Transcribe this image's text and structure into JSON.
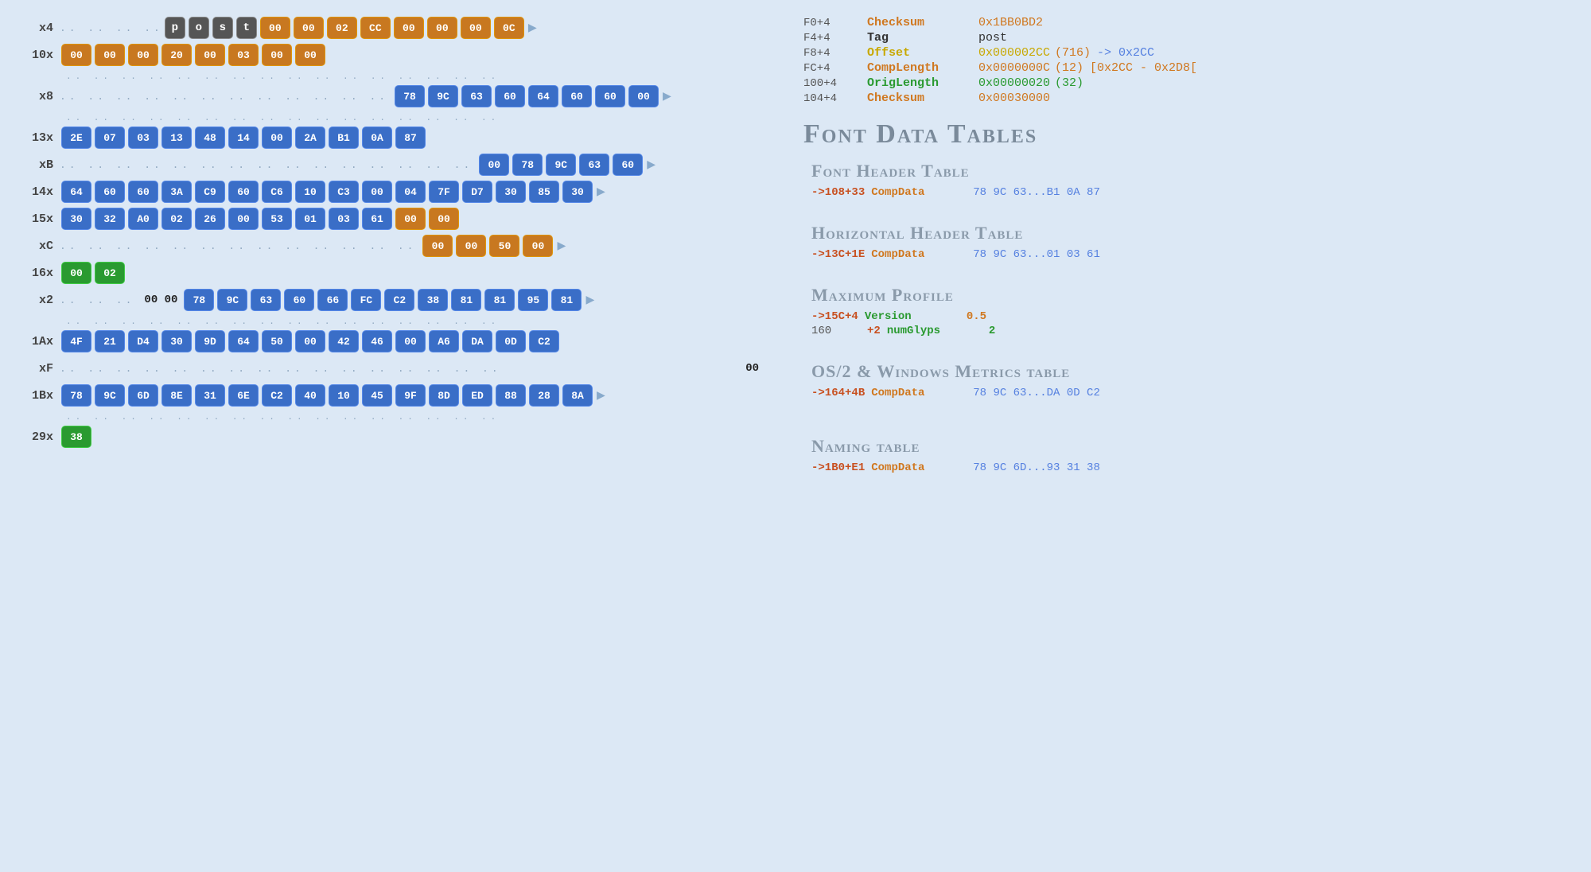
{
  "left": {
    "rows": [
      {
        "id": "row-x4",
        "label": "x4",
        "prefix_dots": ".. .. .. ..",
        "items": [
          {
            "text": "p",
            "type": "gray"
          },
          {
            "text": "o",
            "type": "gray"
          },
          {
            "text": "s",
            "type": "gray"
          },
          {
            "text": "t",
            "type": "gray"
          },
          {
            "text": "00",
            "type": "orange"
          },
          {
            "text": "00",
            "type": "orange"
          },
          {
            "text": "02",
            "type": "orange"
          },
          {
            "text": "CC",
            "type": "orange"
          },
          {
            "text": "00",
            "type": "orange"
          },
          {
            "text": "00",
            "type": "orange"
          },
          {
            "text": "00",
            "type": "orange"
          },
          {
            "text": "0C",
            "type": "orange"
          }
        ],
        "has_arrow": true
      },
      {
        "id": "row-10x",
        "label": "10x",
        "prefix_dots": "",
        "items": [
          {
            "text": "00",
            "type": "orange"
          },
          {
            "text": "00",
            "type": "orange"
          },
          {
            "text": "00",
            "type": "orange"
          },
          {
            "text": "20",
            "type": "orange"
          },
          {
            "text": "00",
            "type": "orange"
          },
          {
            "text": "03",
            "type": "orange"
          },
          {
            "text": "00",
            "type": "orange"
          },
          {
            "text": "00",
            "type": "orange"
          }
        ],
        "has_arrow": false
      },
      {
        "id": "dots-x8-pre",
        "type": "dots",
        "dots": ".. .. .. .. .. .. .. .. .. .. .. .. .. .. .. .."
      },
      {
        "id": "row-x8",
        "label": "x8",
        "prefix_dots": ".. .. .. .. .. .. .. .. .. .. .. ..",
        "items": [
          {
            "text": "78",
            "type": "blue"
          },
          {
            "text": "9C",
            "type": "blue"
          },
          {
            "text": "63",
            "type": "blue"
          },
          {
            "text": "60",
            "type": "blue"
          },
          {
            "text": "64",
            "type": "blue"
          },
          {
            "text": "60",
            "type": "blue"
          },
          {
            "text": "60",
            "type": "blue"
          },
          {
            "text": "00",
            "type": "blue"
          }
        ],
        "has_arrow": true
      },
      {
        "id": "dots-13x-pre",
        "type": "dots",
        "dots": ".. .. .. .. .. .. .. .. .. .. .. .. .. .. .. .."
      },
      {
        "id": "row-13x",
        "label": "13x",
        "prefix_dots": "",
        "items": [
          {
            "text": "2E",
            "type": "blue"
          },
          {
            "text": "07",
            "type": "blue"
          },
          {
            "text": "03",
            "type": "blue"
          },
          {
            "text": "13",
            "type": "blue"
          },
          {
            "text": "48",
            "type": "blue"
          },
          {
            "text": "14",
            "type": "blue"
          },
          {
            "text": "00",
            "type": "blue"
          },
          {
            "text": "2A",
            "type": "blue"
          },
          {
            "text": "B1",
            "type": "blue"
          },
          {
            "text": "0A",
            "type": "blue"
          },
          {
            "text": "87",
            "type": "blue"
          }
        ],
        "has_arrow": false
      },
      {
        "id": "row-xB",
        "label": "xB",
        "prefix_dots": ".. .. .. .. .. .. .. .. .. .. .. .. .. .. ..",
        "items": [
          {
            "text": "00",
            "type": "blue"
          },
          {
            "text": "78",
            "type": "blue"
          },
          {
            "text": "9C",
            "type": "blue"
          },
          {
            "text": "63",
            "type": "blue"
          },
          {
            "text": "60",
            "type": "blue"
          }
        ],
        "has_arrow": true
      },
      {
        "id": "row-14x",
        "label": "14x",
        "prefix_dots": "",
        "items": [
          {
            "text": "64",
            "type": "blue"
          },
          {
            "text": "60",
            "type": "blue"
          },
          {
            "text": "60",
            "type": "blue"
          },
          {
            "text": "3A",
            "type": "blue"
          },
          {
            "text": "C9",
            "type": "blue"
          },
          {
            "text": "60",
            "type": "blue"
          },
          {
            "text": "C6",
            "type": "blue"
          },
          {
            "text": "10",
            "type": "blue"
          },
          {
            "text": "C3",
            "type": "blue"
          },
          {
            "text": "00",
            "type": "blue"
          },
          {
            "text": "04",
            "type": "blue"
          },
          {
            "text": "7F",
            "type": "blue"
          },
          {
            "text": "D7",
            "type": "blue"
          },
          {
            "text": "30",
            "type": "blue"
          },
          {
            "text": "85",
            "type": "blue"
          },
          {
            "text": "30",
            "type": "blue"
          }
        ],
        "has_arrow": true
      },
      {
        "id": "row-15x",
        "label": "15x",
        "prefix_dots": "",
        "items": [
          {
            "text": "30",
            "type": "blue"
          },
          {
            "text": "32",
            "type": "blue"
          },
          {
            "text": "A0",
            "type": "blue"
          },
          {
            "text": "02",
            "type": "blue"
          },
          {
            "text": "26",
            "type": "blue"
          },
          {
            "text": "00",
            "type": "blue"
          },
          {
            "text": "53",
            "type": "blue"
          },
          {
            "text": "01",
            "type": "blue"
          },
          {
            "text": "03",
            "type": "blue"
          },
          {
            "text": "61",
            "type": "blue"
          },
          {
            "text": "00",
            "type": "orange"
          },
          {
            "text": "00",
            "type": "orange"
          }
        ],
        "has_arrow": false
      },
      {
        "id": "row-xC",
        "label": "xC",
        "prefix_dots": ".. .. .. .. .. .. .. .. .. .. .. .. ..",
        "items": [
          {
            "text": "00",
            "type": "orange"
          },
          {
            "text": "00",
            "type": "orange"
          },
          {
            "text": "50",
            "type": "orange"
          },
          {
            "text": "00",
            "type": "orange"
          }
        ],
        "has_arrow": true
      },
      {
        "id": "row-16x",
        "label": "16x",
        "prefix_dots": "",
        "items": [
          {
            "text": "00",
            "type": "green"
          },
          {
            "text": "02",
            "type": "green"
          }
        ],
        "has_arrow": false
      },
      {
        "id": "row-x2",
        "label": "x2",
        "prefix_dots": ".. .. ..",
        "inline_text": "00 00",
        "items": [
          {
            "text": "78",
            "type": "blue"
          },
          {
            "text": "9C",
            "type": "blue"
          },
          {
            "text": "63",
            "type": "blue"
          },
          {
            "text": "60",
            "type": "blue"
          },
          {
            "text": "66",
            "type": "blue"
          },
          {
            "text": "FC",
            "type": "blue"
          },
          {
            "text": "C2",
            "type": "blue"
          },
          {
            "text": "38",
            "type": "blue"
          },
          {
            "text": "81",
            "type": "blue"
          },
          {
            "text": "81",
            "type": "blue"
          },
          {
            "text": "95",
            "type": "blue"
          },
          {
            "text": "81",
            "type": "blue"
          }
        ],
        "has_arrow": true
      },
      {
        "id": "dots-1ax-pre",
        "type": "dots",
        "dots": ".. .. .. .. .. .. .. .. .. .. .. .. .. .. .. .."
      },
      {
        "id": "row-1Ax",
        "label": "1Ax",
        "prefix_dots": "",
        "items": [
          {
            "text": "4F",
            "type": "blue"
          },
          {
            "text": "21",
            "type": "blue"
          },
          {
            "text": "D4",
            "type": "blue"
          },
          {
            "text": "30",
            "type": "blue"
          },
          {
            "text": "9D",
            "type": "blue"
          },
          {
            "text": "64",
            "type": "blue"
          },
          {
            "text": "50",
            "type": "blue"
          },
          {
            "text": "00",
            "type": "blue"
          },
          {
            "text": "42",
            "type": "blue"
          },
          {
            "text": "46",
            "type": "blue"
          },
          {
            "text": "00",
            "type": "blue"
          },
          {
            "text": "A6",
            "type": "blue"
          },
          {
            "text": "DA",
            "type": "blue"
          },
          {
            "text": "0D",
            "type": "blue"
          },
          {
            "text": "C2",
            "type": "blue"
          }
        ],
        "has_arrow": false
      },
      {
        "id": "row-xF",
        "label": "xF",
        "prefix_dots": ".. .. .. .. .. .. .. .. .. .. .. .. .. .. .. ..",
        "inline_end": "00",
        "items": [],
        "has_arrow": false
      },
      {
        "id": "row-1Bx",
        "label": "1Bx",
        "prefix_dots": "",
        "items": [
          {
            "text": "78",
            "type": "blue"
          },
          {
            "text": "9C",
            "type": "blue"
          },
          {
            "text": "6D",
            "type": "blue"
          },
          {
            "text": "8E",
            "type": "blue"
          },
          {
            "text": "31",
            "type": "blue"
          },
          {
            "text": "6E",
            "type": "blue"
          },
          {
            "text": "C2",
            "type": "blue"
          },
          {
            "text": "40",
            "type": "blue"
          },
          {
            "text": "10",
            "type": "blue"
          },
          {
            "text": "45",
            "type": "blue"
          },
          {
            "text": "9F",
            "type": "blue"
          },
          {
            "text": "8D",
            "type": "blue"
          },
          {
            "text": "ED",
            "type": "blue"
          },
          {
            "text": "88",
            "type": "blue"
          },
          {
            "text": "28",
            "type": "blue"
          },
          {
            "text": "8A",
            "type": "blue"
          }
        ],
        "has_arrow": true
      },
      {
        "id": "dots-29x-pre",
        "type": "dots",
        "dots": ".. .. .. .. .. .. .. .. .. .. .. .. .. .. .. .."
      },
      {
        "id": "row-29x",
        "label": "29x",
        "prefix_dots": "",
        "items": [
          {
            "text": "38",
            "type": "green"
          }
        ],
        "has_arrow": false
      }
    ]
  },
  "right": {
    "top_entries": [
      {
        "offset": "F0+4",
        "field": "Checksum",
        "field_color": "orange",
        "value": "0x1BB0BD2",
        "value_color": "orange"
      },
      {
        "offset": "F4+4",
        "field": "Tag",
        "field_color": "white",
        "value": "post",
        "value_color": "white"
      },
      {
        "offset": "F8+4",
        "field": "Offset",
        "field_color": "yellow",
        "value": "0x000002CC",
        "value_color": "yellow",
        "paren": "(716)",
        "extra": "-> 0x2CC",
        "extra_color": "blue"
      },
      {
        "offset": "FC+4",
        "field": "CompLength",
        "field_color": "orange",
        "value": "0x0000000C",
        "value_color": "orange",
        "paren": "(12)",
        "bracket": "[0x2CC - 0x2D8["
      },
      {
        "offset": "100+4",
        "field": "OrigLength",
        "field_color": "green",
        "value": "0x00000020",
        "value_color": "green",
        "paren": "(32)"
      },
      {
        "offset": "104+4",
        "field": "Checksum",
        "field_color": "orange",
        "value": "0x00030000",
        "value_color": "orange"
      }
    ],
    "main_title": "Font Data Tables",
    "tables": [
      {
        "id": "font-header",
        "title": "Font Header Table",
        "entries": [
          {
            "addr": "->108",
            "plus": "+33",
            "field": "CompData",
            "field_color": "orange",
            "value": "78 9C 63...B1 0A 87",
            "value_color": "blue"
          }
        ]
      },
      {
        "id": "horiz-header",
        "title": "Horizontal Header Table",
        "entries": [
          {
            "addr": "->13C",
            "plus": "+1E",
            "field": "CompData",
            "field_color": "orange",
            "value": "78 9C 63...01 03 61",
            "value_color": "blue"
          }
        ]
      },
      {
        "id": "max-profile",
        "title": "Maximum Profile",
        "entries": [
          {
            "addr": "->15C",
            "plus": "+4",
            "field": "Version",
            "field_color": "green",
            "value": "0.5",
            "value_color": "orange"
          },
          {
            "addr": "160",
            "plus": "+2",
            "field": "numGlyps",
            "field_color": "green",
            "value": "2",
            "value_color": "green"
          }
        ]
      },
      {
        "id": "os2",
        "title": "OS/2 & Windows Metrics table",
        "entries": [
          {
            "addr": "->164",
            "plus": "+4B",
            "field": "CompData",
            "field_color": "orange",
            "value": "78 9C 63...DA 0D C2",
            "value_color": "blue"
          }
        ]
      },
      {
        "id": "naming",
        "title": "Naming table",
        "entries": [
          {
            "addr": "->1B0",
            "plus": "+E1",
            "field": "CompData",
            "field_color": "orange",
            "value": "78 9C 6D...93 31 38",
            "value_color": "blue"
          }
        ]
      }
    ]
  },
  "colors": {
    "blue_byte": "#3a6ec7",
    "orange_byte": "#c87820",
    "green_byte": "#2a9a30",
    "gray_byte": "#555555",
    "bg": "#dce8f5",
    "text_orange": "#d07820",
    "text_yellow": "#c8a800",
    "text_green": "#2a9a30",
    "text_blue": "#5580e0",
    "text_gray": "#7a8a9a"
  }
}
